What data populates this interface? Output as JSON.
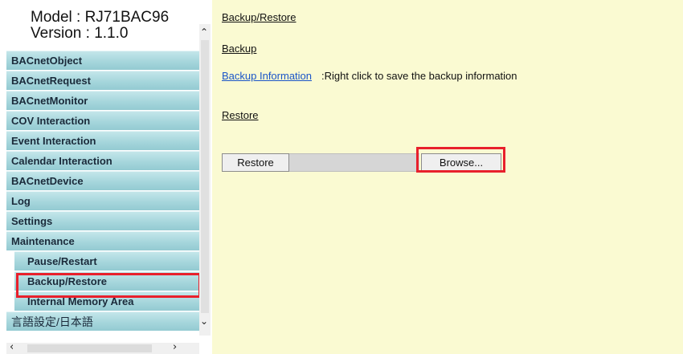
{
  "sidebar": {
    "model": "Model : RJ71BAC96",
    "version": "Version : 1.1.0",
    "items": [
      {
        "label": "BACnetObject"
      },
      {
        "label": "BACnetRequest"
      },
      {
        "label": "BACnetMonitor"
      },
      {
        "label": "COV Interaction"
      },
      {
        "label": "Event Interaction"
      },
      {
        "label": "Calendar Interaction"
      },
      {
        "label": "BACnetDevice"
      },
      {
        "label": "Log"
      },
      {
        "label": "Settings"
      },
      {
        "label": "Maintenance"
      },
      {
        "label": "Pause/Restart"
      },
      {
        "label": "Backup/Restore"
      },
      {
        "label": "Internal Memory Area"
      },
      {
        "label": "言語設定/日本語"
      }
    ],
    "scroll_up_icon": "chevron-up-icon",
    "scroll_down_icon": "chevron-down-icon",
    "scroll_left_icon": "chevron-left-icon",
    "scroll_right_icon": "chevron-right-icon"
  },
  "main": {
    "breadcrumb": "Backup/Restore",
    "backup_heading": "Backup",
    "backup_info_link": "Backup Information",
    "backup_info_text": ":Right click to save the backup information",
    "restore_heading": "Restore",
    "restore_button": "Restore",
    "browse_button": "Browse..."
  },
  "colors": {
    "menu": "#a6d6dc",
    "content_bg": "#fafad2",
    "highlight": "#e8202c",
    "link": "#1a55c8"
  }
}
